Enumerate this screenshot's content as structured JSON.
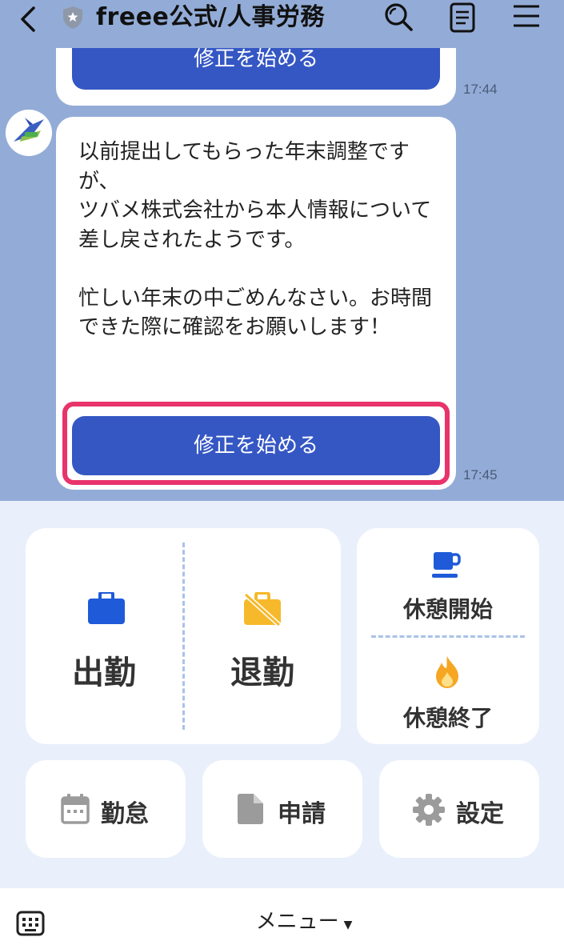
{
  "header": {
    "title": "freee公式/人事労務"
  },
  "messages": [
    {
      "button_label": "修正を始める",
      "time": "17:44"
    },
    {
      "text": "以前提出してもらった年末調整ですが、\nツバメ株式会社から本人情報について差し戻されたようです。\n\n忙しい年末の中ごめんなさい。お時間できた際に確認をお願いします！",
      "button_label": "修正を始める",
      "time": "17:45"
    }
  ],
  "rich_menu": {
    "clock_in": "出勤",
    "clock_out": "退勤",
    "break_start": "休憩開始",
    "break_end": "休憩終了",
    "attendance": "勤怠",
    "application": "申請",
    "settings": "設定"
  },
  "bottom_bar": {
    "menu_label": "メニュー"
  },
  "colors": {
    "chat_bg": "#93acd7",
    "primary_button": "#3557c4",
    "highlight": "#e8336b",
    "menu_bg": "#e9f0fb",
    "clock_in_icon": "#1f5bd8",
    "clock_out_icon": "#f6b92b"
  },
  "icons": {
    "back": "back-icon",
    "verified": "shield-icon",
    "search": "search-icon",
    "notes": "notes-icon",
    "menu": "hamburger-icon",
    "clock_in": "briefcase-icon",
    "clock_out": "briefcase-off-icon",
    "break_start": "coffee-cup-icon",
    "break_end": "flame-icon",
    "attendance": "calendar-icon",
    "application": "document-icon",
    "settings": "gear-icon",
    "keyboard": "keyboard-icon"
  }
}
